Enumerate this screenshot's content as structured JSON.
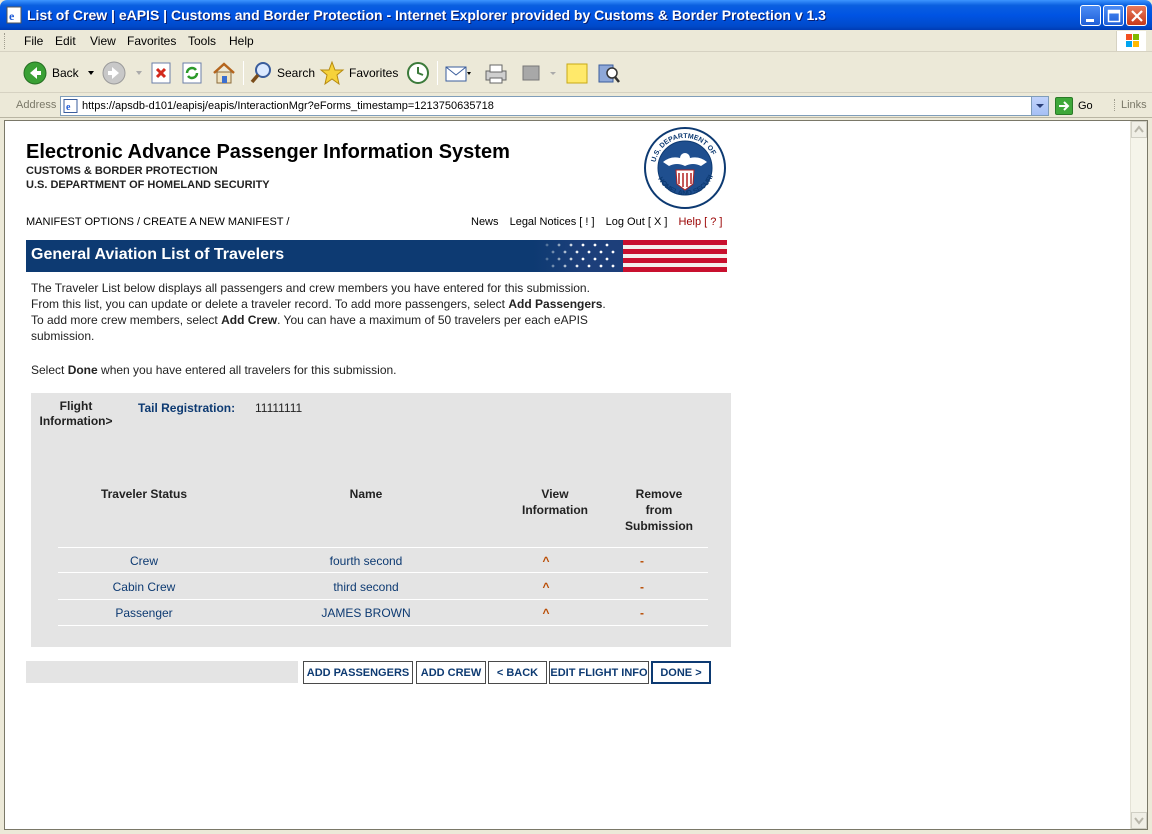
{
  "window": {
    "title": "List of Crew | eAPIS | Customs and Border Protection - Internet Explorer provided by Customs & Border Protection v 1.3"
  },
  "menu": {
    "items": [
      {
        "label": "File"
      },
      {
        "label": "Edit"
      },
      {
        "label": "View"
      },
      {
        "label": "Favorites"
      },
      {
        "label": "Tools"
      },
      {
        "label": "Help"
      }
    ]
  },
  "toolbar": {
    "back_label": "Back",
    "search_label": "Search",
    "favorites_label": "Favorites"
  },
  "addressbar": {
    "label": "Address",
    "url": "https://apsdb-d101/eapisj/eapis/InteractionMgr?eForms_timestamp=1213750635718",
    "go_label": "Go",
    "links_label": "Links"
  },
  "site": {
    "title": "Electronic Advance Passenger Information System",
    "sub1": "CUSTOMS & BORDER PROTECTION",
    "sub2": "U.S. DEPARTMENT OF HOMELAND SECURITY",
    "seal_text": "U.S. DEPARTMENT OF HOMELAND SECURITY"
  },
  "nav": {
    "breadcrumb": "MANIFEST OPTIONS / CREATE A NEW MANIFEST /",
    "news": "News",
    "legal": "Legal Notices [ ! ]",
    "logout": "Log Out [ X ]",
    "help": "Help [ ? ]"
  },
  "banner": {
    "title": "General Aviation List of Travelers"
  },
  "intro": {
    "p1_a": "The Traveler List below displays all passengers and crew members you have entered for this submission. From this list, you can update or delete a traveler record. To add more passengers, select ",
    "p1_b": "Add Passengers",
    "p1_c": ". To add more crew members, select ",
    "p1_d": "Add Crew",
    "p1_e": ". You can have a maximum of 50 travelers per each eAPIS submission.",
    "p2_a": "Select ",
    "p2_b": "Done",
    "p2_c": " when you have entered all travelers for this submission."
  },
  "flight": {
    "info_label_1": "Flight",
    "info_label_2": "Information>",
    "tail_label": "Tail Registration:",
    "tail_value": "11111111"
  },
  "table": {
    "headers": {
      "status": "Traveler Status",
      "name": "Name",
      "view_1": "View",
      "view_2": "Information",
      "remove_1": "Remove",
      "remove_2": "from",
      "remove_3": "Submission"
    },
    "rows": [
      {
        "status": "Crew",
        "name": "fourth second",
        "view": "^",
        "remove": "-"
      },
      {
        "status": "Cabin Crew",
        "name": "third second",
        "view": "^",
        "remove": "-"
      },
      {
        "status": "Passenger",
        "name": "JAMES BROWN",
        "view": "^",
        "remove": "-"
      }
    ]
  },
  "buttons": {
    "add_passengers": "ADD PASSENGERS",
    "add_crew": "ADD CREW",
    "back": "< BACK",
    "edit_flight": "EDIT FLIGHT INFO",
    "done": "DONE >"
  },
  "colors": {
    "titlebar": "#0054e3",
    "banner": "#0d3a72",
    "link_blue": "#0d3a72",
    "action_orange": "#b94a00",
    "help_red": "#990000",
    "panel_gray": "#e4e4e4"
  }
}
